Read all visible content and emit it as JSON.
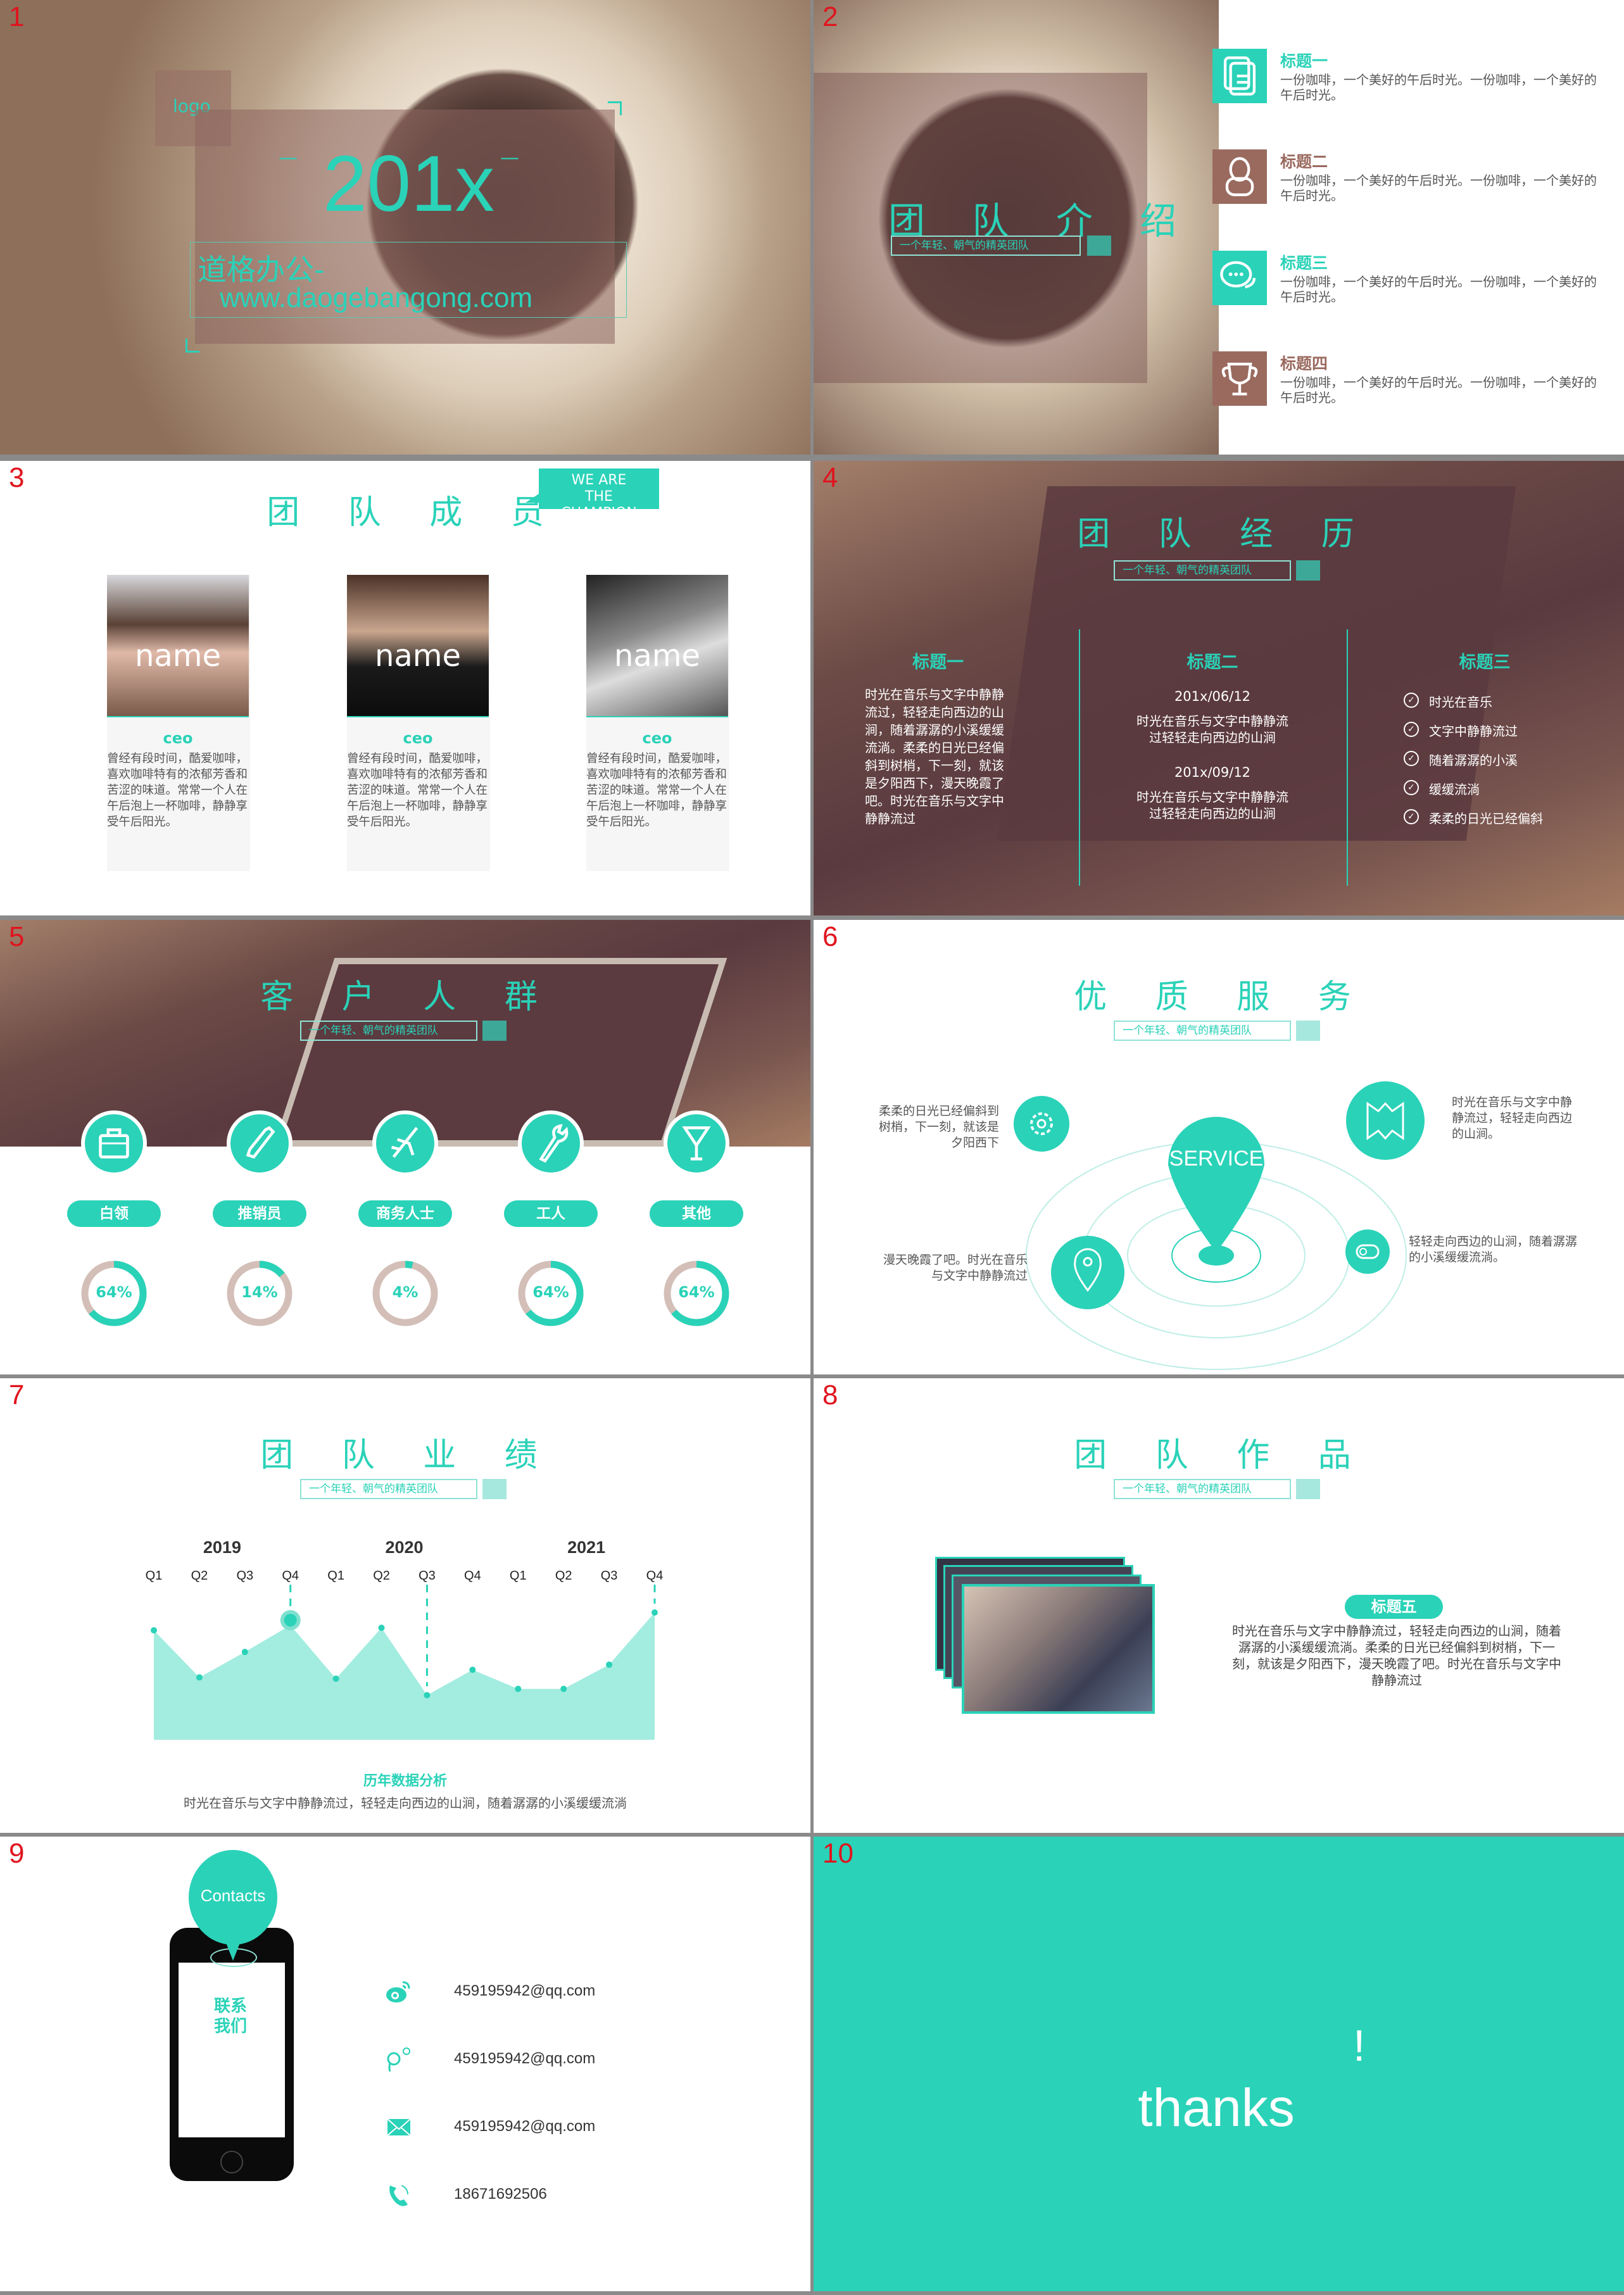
{
  "colors": {
    "accent": "#2ad2b8",
    "brown": "#9a6a5f",
    "ring_track": "#d3bfb8"
  },
  "slide_numbers": [
    "1",
    "2",
    "3",
    "4",
    "5",
    "6",
    "7",
    "8",
    "9",
    "10"
  ],
  "subtitle": "一个年轻、朝气的精英团队",
  "s1": {
    "logo": "logo",
    "year": "201x",
    "dash": "—",
    "brand": "道格办公-",
    "url": "www.daogebangong.com"
  },
  "s2": {
    "title": "团 队 介 绍",
    "items": [
      {
        "title": "标题一",
        "text": "一份咖啡，一个美好的午后时光。一份咖啡，一个美好的午后时光。",
        "icon": "document-icon",
        "color": "#2ad2b8"
      },
      {
        "title": "标题二",
        "text": "一份咖啡，一个美好的午后时光。一份咖啡，一个美好的午后时光。",
        "icon": "user-icon",
        "color": "#9a6a5f"
      },
      {
        "title": "标题三",
        "text": "一份咖啡，一个美好的午后时光。一份咖啡，一个美好的午后时光。",
        "icon": "chat-icon",
        "color": "#2ad2b8"
      },
      {
        "title": "标题四",
        "text": "一份咖啡，一个美好的午后时光。一份咖啡，一个美好的午后时光。",
        "icon": "trophy-icon",
        "color": "#9a6a5f"
      }
    ]
  },
  "s3": {
    "title": "团 队 成 员",
    "badge": "WE ARE THE CHAMPION",
    "members": [
      {
        "name": "name",
        "role": "ceo",
        "text": "曾经有段时间，酷爱咖啡，喜欢咖啡特有的浓郁芳香和苦涩的味道。常常一个人在午后泡上一杯咖啡，静静享受午后阳光。"
      },
      {
        "name": "name",
        "role": "ceo",
        "text": "曾经有段时间，酷爱咖啡，喜欢咖啡特有的浓郁芳香和苦涩的味道。常常一个人在午后泡上一杯咖啡，静静享受午后阳光。"
      },
      {
        "name": "name",
        "role": "ceo",
        "text": "曾经有段时间，酷爱咖啡，喜欢咖啡特有的浓郁芳香和苦涩的味道。常常一个人在午后泡上一杯咖啡，静静享受午后阳光。"
      }
    ]
  },
  "s4": {
    "title": "团 队 经 历",
    "col1": {
      "title": "标题一",
      "text": "时光在音乐与文字中静静流过，轻轻走向西边的山涧，随着潺潺的小溪缓缓流淌。柔柔的日光已经偏斜到树梢，下一刻，就该是夕阳西下，漫天晚霞了吧。时光在音乐与文字中静静流过"
    },
    "col2": {
      "title": "标题二",
      "entries": [
        {
          "date": "201x/06/12",
          "text": "时光在音乐与文字中静静流过轻轻走向西边的山涧"
        },
        {
          "date": "201x/09/12",
          "text": "时光在音乐与文字中静静流过轻轻走向西边的山涧"
        }
      ]
    },
    "col3": {
      "title": "标题三",
      "list": [
        "时光在音乐",
        "文字中静静流过",
        "随着潺潺的小溪",
        "缓缓流淌",
        "柔柔的日光已经偏斜"
      ]
    }
  },
  "s5": {
    "title": "客 户 人 群",
    "groups": [
      {
        "label": "白领",
        "icon": "briefcase-icon",
        "percent_label": "64%",
        "percent": 64
      },
      {
        "label": "推销员",
        "icon": "phone-icon",
        "percent_label": "14%",
        "percent": 14
      },
      {
        "label": "商务人士",
        "icon": "airplane-icon",
        "percent_label": "4%",
        "percent": 4
      },
      {
        "label": "工人",
        "icon": "wrench-icon",
        "percent_label": "64%",
        "percent": 64
      },
      {
        "label": "其他",
        "icon": "cocktail-icon",
        "percent_label": "64%",
        "percent": 64
      }
    ]
  },
  "s6": {
    "title": "优 质 服 务",
    "center": "SERVICE",
    "gear_text": "柔柔的日光已经偏斜到树梢，下一刻，就该是夕阳西下",
    "map_text": "时光在音乐与文字中静静流过，轻轻走向西边的山涧。",
    "location_text": "漫天晚霞了吧。时光在音乐与文字中静静流过",
    "toggle_text": "轻轻走向西边的山涧，随着潺潺的小溪缓缓流淌。"
  },
  "s7": {
    "title": "团 队 业 绩",
    "caption": "历年数据分析",
    "desc": "时光在音乐与文字中静静流过，轻轻走向西边的山涧，随着潺潺的小溪缓缓流淌"
  },
  "chart_data": {
    "type": "area",
    "years": [
      "2019",
      "2020",
      "2021"
    ],
    "categories": [
      "Q1",
      "Q2",
      "Q3",
      "Q4",
      "Q1",
      "Q2",
      "Q3",
      "Q4",
      "Q1",
      "Q2",
      "Q3",
      "Q4"
    ],
    "values": [
      86,
      49,
      69,
      90,
      48,
      88,
      35,
      55,
      40,
      40,
      59,
      100
    ],
    "highlight_index": 3,
    "dashed_indices": [
      3,
      6,
      11
    ],
    "grid": false
  },
  "s8": {
    "title": "团 队 作 品",
    "tag": "标题五",
    "text": "时光在音乐与文字中静静流过，轻轻走向西边的山涧，随着潺潺的小溪缓缓流淌。柔柔的日光已经偏斜到树梢，下一刻，就该是夕阳西下，漫天晚霞了吧。时光在音乐与文字中静静流过"
  },
  "s9": {
    "bubble": "Contacts",
    "screen": "联系我们",
    "contacts": [
      {
        "icon": "weibo-icon",
        "value": "459195942@qq.com"
      },
      {
        "icon": "qq-icon",
        "value": "459195942@qq.com"
      },
      {
        "icon": "mail-icon",
        "value": "459195942@qq.com"
      },
      {
        "icon": "phone-icon",
        "value": "18671692506"
      }
    ]
  },
  "s10": {
    "text": "thanks",
    "mark": "!"
  }
}
